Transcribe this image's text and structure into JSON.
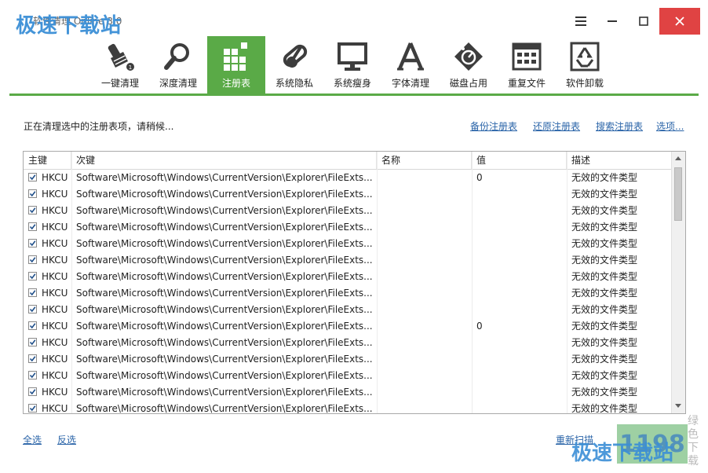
{
  "window": {
    "title": "软件清理 Online 3.0",
    "watermark_top": "极速下载站"
  },
  "toolbar": {
    "items": [
      {
        "label": "一键清理",
        "icon": "broom-icon"
      },
      {
        "label": "深度清理",
        "icon": "magnifier-icon"
      },
      {
        "label": "注册表",
        "icon": "registry-blocks-icon",
        "active": true
      },
      {
        "label": "系统隐私",
        "icon": "pill-capsule-icon"
      },
      {
        "label": "系统瘦身",
        "icon": "monitor-icon"
      },
      {
        "label": "字体清理",
        "icon": "font-a-icon"
      },
      {
        "label": "磁盘占用",
        "icon": "disk-gauge-icon"
      },
      {
        "label": "重复文件",
        "icon": "duplicate-files-icon"
      },
      {
        "label": "软件卸载",
        "icon": "recycle-icon"
      }
    ],
    "accent": "#5aaa47"
  },
  "status": {
    "text": "正在清理选中的注册表项，请稍候..."
  },
  "links": {
    "backup": "备份注册表",
    "restore": "还原注册表",
    "search": "搜索注册表",
    "options": "选项..."
  },
  "table": {
    "columns": [
      "主键",
      "次键",
      "名称",
      "值",
      "描述"
    ],
    "rows": [
      {
        "checked": true,
        "key": "HKCU",
        "subkey": "Software\\Microsoft\\Windows\\CurrentVersion\\Explorer\\FileExts...",
        "name": "",
        "value": "0",
        "desc": "无效的文件类型"
      },
      {
        "checked": true,
        "key": "HKCU",
        "subkey": "Software\\Microsoft\\Windows\\CurrentVersion\\Explorer\\FileExts...",
        "name": "",
        "value": "",
        "desc": "无效的文件类型"
      },
      {
        "checked": true,
        "key": "HKCU",
        "subkey": "Software\\Microsoft\\Windows\\CurrentVersion\\Explorer\\FileExts...",
        "name": "",
        "value": "",
        "desc": "无效的文件类型"
      },
      {
        "checked": true,
        "key": "HKCU",
        "subkey": "Software\\Microsoft\\Windows\\CurrentVersion\\Explorer\\FileExts...",
        "name": "",
        "value": "",
        "desc": "无效的文件类型"
      },
      {
        "checked": true,
        "key": "HKCU",
        "subkey": "Software\\Microsoft\\Windows\\CurrentVersion\\Explorer\\FileExts...",
        "name": "",
        "value": "",
        "desc": "无效的文件类型"
      },
      {
        "checked": true,
        "key": "HKCU",
        "subkey": "Software\\Microsoft\\Windows\\CurrentVersion\\Explorer\\FileExts...",
        "name": "",
        "value": "",
        "desc": "无效的文件类型"
      },
      {
        "checked": true,
        "key": "HKCU",
        "subkey": "Software\\Microsoft\\Windows\\CurrentVersion\\Explorer\\FileExts...",
        "name": "",
        "value": "",
        "desc": "无效的文件类型"
      },
      {
        "checked": true,
        "key": "HKCU",
        "subkey": "Software\\Microsoft\\Windows\\CurrentVersion\\Explorer\\FileExts...",
        "name": "",
        "value": "",
        "desc": "无效的文件类型"
      },
      {
        "checked": true,
        "key": "HKCU",
        "subkey": "Software\\Microsoft\\Windows\\CurrentVersion\\Explorer\\FileExts...",
        "name": "",
        "value": "",
        "desc": "无效的文件类型"
      },
      {
        "checked": true,
        "key": "HKCU",
        "subkey": "Software\\Microsoft\\Windows\\CurrentVersion\\Explorer\\FileExts...",
        "name": "",
        "value": "0",
        "desc": "无效的文件类型"
      },
      {
        "checked": true,
        "key": "HKCU",
        "subkey": "Software\\Microsoft\\Windows\\CurrentVersion\\Explorer\\FileExts...",
        "name": "",
        "value": "",
        "desc": "无效的文件类型"
      },
      {
        "checked": true,
        "key": "HKCU",
        "subkey": "Software\\Microsoft\\Windows\\CurrentVersion\\Explorer\\FileExts...",
        "name": "",
        "value": "",
        "desc": "无效的文件类型"
      },
      {
        "checked": true,
        "key": "HKCU",
        "subkey": "Software\\Microsoft\\Windows\\CurrentVersion\\Explorer\\FileExts...",
        "name": "",
        "value": "",
        "desc": "无效的文件类型"
      },
      {
        "checked": true,
        "key": "HKCU",
        "subkey": "Software\\Microsoft\\Windows\\CurrentVersion\\Explorer\\FileExts...",
        "name": "",
        "value": "",
        "desc": "无效的文件类型"
      },
      {
        "checked": true,
        "key": "HKCU",
        "subkey": "Software\\Microsoft\\Windows\\CurrentVersion\\Explorer\\FileExts...",
        "name": "",
        "value": "",
        "desc": "无效的文件类型"
      }
    ]
  },
  "bottom": {
    "select_all": "全选",
    "invert": "反选",
    "rescan": "重新扫描",
    "watermark_bottom": "极速下载站",
    "watermark_side": "绿色下载"
  }
}
